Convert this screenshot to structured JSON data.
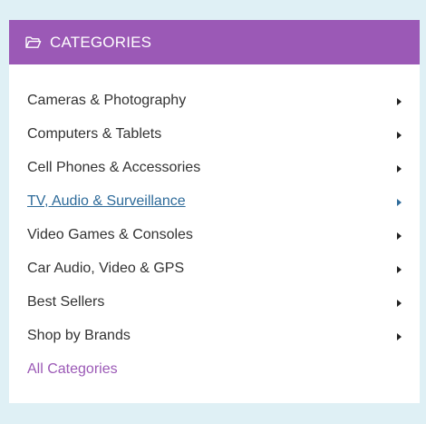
{
  "header": {
    "title": "CATEGORIES",
    "icon": "folder-open-icon",
    "background": "#9b59b6"
  },
  "categories": [
    {
      "label": "Cameras & Photography",
      "icon": "chevron-right-icon"
    },
    {
      "label": "Computers & Tablets",
      "icon": "chevron-right-icon"
    },
    {
      "label": "Cell Phones & Accessories",
      "icon": "chevron-right-icon"
    },
    {
      "label": "TV, Audio & Surveillance",
      "icon": "chevron-right-icon",
      "active": true
    },
    {
      "label": "Video Games & Consoles",
      "icon": "chevron-right-icon"
    },
    {
      "label": "Car Audio, Video & GPS",
      "icon": "chevron-right-icon"
    },
    {
      "label": "Best Sellers",
      "icon": "chevron-right-icon"
    },
    {
      "label": "Shop by Brands",
      "icon": "chevron-right-icon"
    }
  ],
  "all_categories": {
    "label": "All Categories",
    "color": "#9b59b6"
  },
  "colors": {
    "page_background": "#dff0f5",
    "active_link": "#2e6b9a"
  }
}
